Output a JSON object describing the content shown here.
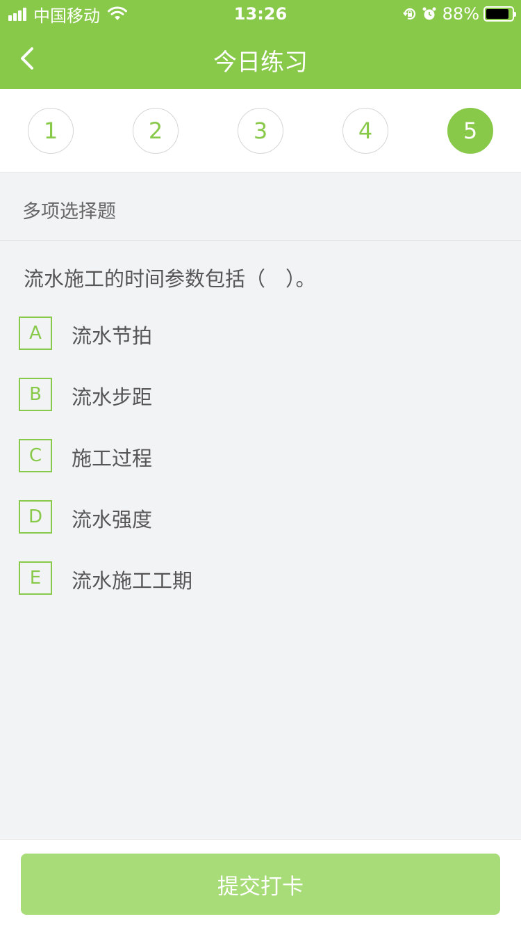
{
  "status_bar": {
    "carrier": "中国移动",
    "time": "13:26",
    "battery_percent": "88%",
    "battery_level": 0.88
  },
  "nav": {
    "title": "今日练习",
    "back_icon": "chevron-left-icon"
  },
  "steps": {
    "items": [
      "1",
      "2",
      "3",
      "4",
      "5"
    ],
    "active_index": 4
  },
  "question": {
    "type_label": "多项选择题",
    "text": "流水施工的时间参数包括（　）。",
    "options": [
      {
        "letter": "A",
        "text": "流水节拍"
      },
      {
        "letter": "B",
        "text": "流水步距"
      },
      {
        "letter": "C",
        "text": "施工过程"
      },
      {
        "letter": "D",
        "text": "流水强度"
      },
      {
        "letter": "E",
        "text": "流水施工工期"
      }
    ]
  },
  "footer": {
    "submit_label": "提交打卡"
  },
  "colors": {
    "accent": "#88c94a",
    "submit_disabled": "#a8dc78",
    "background": "#f1f3f5"
  }
}
